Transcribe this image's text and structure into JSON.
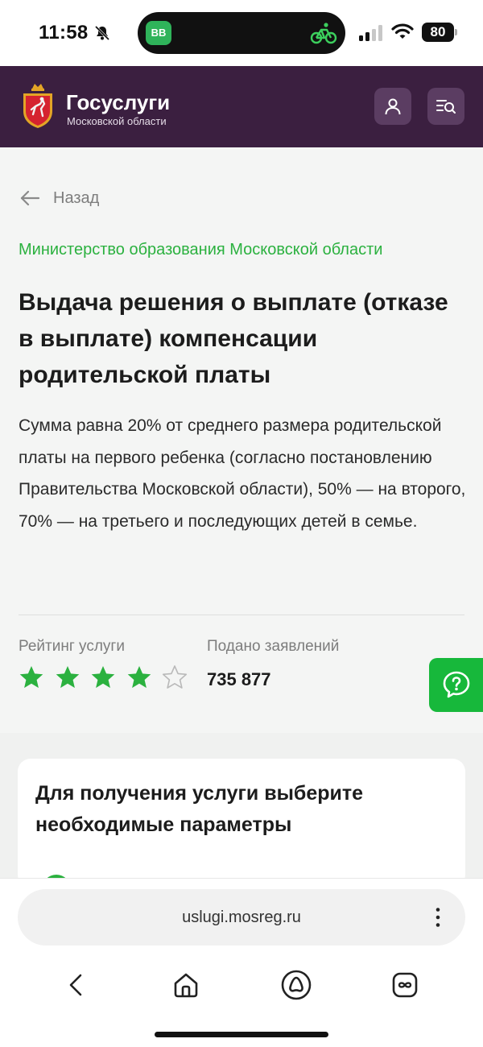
{
  "status_bar": {
    "time": "11:58",
    "island_app_label": "BB",
    "battery_level": "80"
  },
  "header": {
    "brand_title": "Госуслуги",
    "brand_subtitle": "Московской области",
    "user_icon": "user-icon",
    "search_icon": "search-list-icon"
  },
  "content": {
    "back_label": "Назад",
    "ministry": "Министерство образования Московской области",
    "title": "Выдача решения о выплате (отказе в выплате) компенсации родительской платы",
    "description": "Сумма равна 20% от среднего размера родительской платы на первого ребенка (согласно постановлению Правительства Московской области), 50% — на второго, 70% — на третьего и последующих детей в семье.",
    "rating_label": "Рейтинг услуги",
    "rating_value": 4,
    "rating_max": 5,
    "applications_label": "Подано заявлений",
    "applications_count": "735 877"
  },
  "card": {
    "title": "Для получения услуги выберите необходимые параметры"
  },
  "browser": {
    "url": "uslugi.mosreg.ru"
  },
  "colors": {
    "header_bg": "#3b1f40",
    "accent_green": "#2bb13f",
    "star_empty": "#b9b9b9"
  }
}
